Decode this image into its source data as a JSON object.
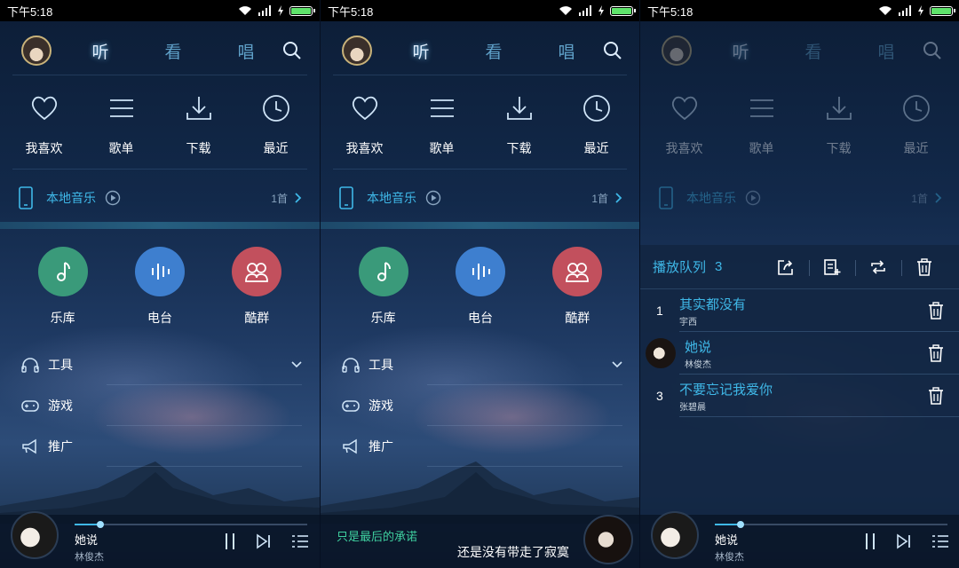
{
  "status": {
    "time": "下午5:18"
  },
  "nav": {
    "tabs": [
      "听",
      "看",
      "唱"
    ]
  },
  "quick": [
    {
      "label": "我喜欢",
      "icon": "heart-icon"
    },
    {
      "label": "歌单",
      "icon": "list-icon"
    },
    {
      "label": "下载",
      "icon": "download-icon"
    },
    {
      "label": "最近",
      "icon": "clock-icon"
    }
  ],
  "local": {
    "label": "本地音乐",
    "count": "1首"
  },
  "categories": [
    {
      "label": "乐库",
      "color": "#3a9a7a",
      "icon": "music-note-icon"
    },
    {
      "label": "电台",
      "color": "#3e7fcf",
      "icon": "radio-bars-icon"
    },
    {
      "label": "酷群",
      "color": "#c2505d",
      "icon": "group-icon"
    }
  ],
  "menu": [
    {
      "label": "工具",
      "icon": "headphones-icon"
    },
    {
      "label": "游戏",
      "icon": "gamepad-icon"
    },
    {
      "label": "推广",
      "icon": "megaphone-icon"
    }
  ],
  "player": {
    "title": "她说",
    "artist": "林俊杰",
    "progress": 0.11
  },
  "lyrics": {
    "line1": "只是最后的承诺",
    "line2": "还是没有带走了寂寞"
  },
  "queue": {
    "title": "播放队列",
    "count": "3",
    "items": [
      {
        "index": "1",
        "title": "其实都没有",
        "artist": "宇西"
      },
      {
        "index": "",
        "title": "她说",
        "artist": "林俊杰"
      },
      {
        "index": "3",
        "title": "不要忘记我爱你",
        "artist": "张碧晨"
      }
    ]
  },
  "colors": {
    "accent": "#3fb8e8",
    "lyricGreen": "#3fd0a0"
  }
}
